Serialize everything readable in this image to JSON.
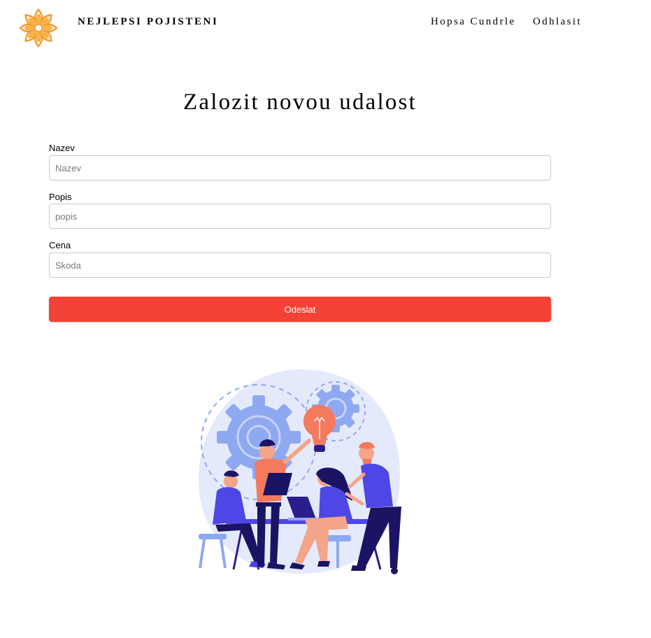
{
  "header": {
    "brand": "NEJLEPSI POJISTENI",
    "logo_icon": "sun-flower-logo-icon",
    "nav": [
      {
        "label": "Hopsa Cundrle"
      },
      {
        "label": "Odhlasit"
      }
    ]
  },
  "form": {
    "title": "Zalozit novou udalost",
    "fields": [
      {
        "label": "Nazev",
        "placeholder": "Nazev",
        "value": ""
      },
      {
        "label": "Popis",
        "placeholder": "popis",
        "value": ""
      },
      {
        "label": "Cena",
        "placeholder": "Skoda",
        "value": ""
      }
    ],
    "submit_label": "Odeslat"
  },
  "illustration": {
    "icon": "team-brainstorming-illustration"
  },
  "colors": {
    "accent": "#f44336",
    "logo_orange": "#f39a2b",
    "illustration_blue": "#4f46e5",
    "illustration_light": "#e4eafb",
    "illustration_gear": "#8fa8f2",
    "illustration_coral": "#f47a5e"
  }
}
